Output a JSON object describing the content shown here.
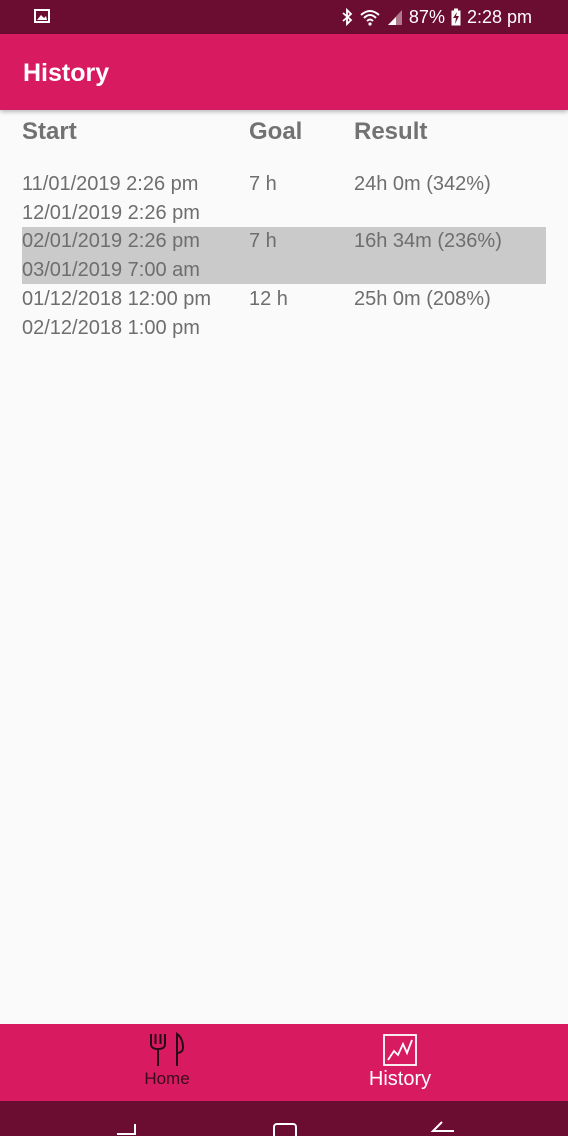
{
  "status_bar": {
    "battery": "87%",
    "time": "2:28 pm",
    "icons": [
      "gallery-icon",
      "bluetooth-icon",
      "wifi-icon",
      "signal-icon",
      "battery-charging-icon"
    ]
  },
  "app_bar": {
    "title": "History"
  },
  "table": {
    "headers": {
      "start": "Start",
      "goal": "Goal",
      "result": "Result"
    },
    "rows": [
      {
        "start": "11/01/2019 2:26 pm",
        "end": "12/01/2019 2:26 pm",
        "goal": "7 h",
        "result": "24h 0m (342%)",
        "selected": false
      },
      {
        "start": "02/01/2019 2:26 pm",
        "end": "03/01/2019 7:00 am",
        "goal": "7 h",
        "result": "16h 34m (236%)",
        "selected": true
      },
      {
        "start": "01/12/2018 12:00 pm",
        "end": "02/12/2018 1:00 pm",
        "goal": "12 h",
        "result": "25h 0m (208%)",
        "selected": false
      }
    ]
  },
  "bottom_nav": {
    "items": [
      {
        "label": "Home",
        "icon": "fork-knife-icon",
        "active": false
      },
      {
        "label": "History",
        "icon": "chart-icon",
        "active": true
      }
    ]
  },
  "system_nav": {
    "icons": [
      "recent-apps-icon",
      "home-icon",
      "back-icon"
    ]
  },
  "colors": {
    "status_bar": "#6b0c31",
    "primary": "#d81b60",
    "background": "#fafafa",
    "selected_row": "#cacaca",
    "text": "#6e6e6e"
  }
}
